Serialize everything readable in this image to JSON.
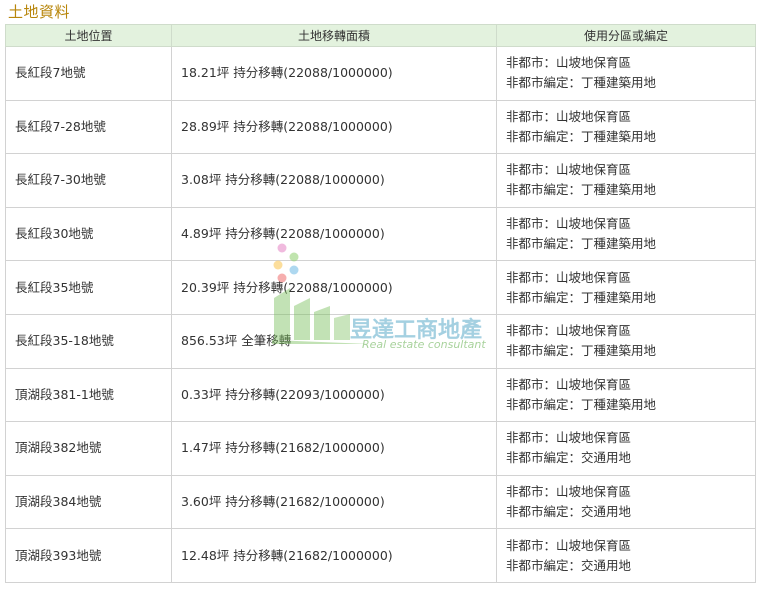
{
  "section_title": "土地資料",
  "table": {
    "headers": [
      "土地位置",
      "土地移轉面積",
      "使用分區或編定"
    ],
    "rows": [
      {
        "location": "長紅段7地號",
        "area": "18.21坪 持分移轉(22088/1000000)",
        "zone1": "非都市：山坡地保育區",
        "zone2": "非都市編定：丁種建築用地"
      },
      {
        "location": "長紅段7-28地號",
        "area": "28.89坪 持分移轉(22088/1000000)",
        "zone1": "非都市：山坡地保育區",
        "zone2": "非都市編定：丁種建築用地"
      },
      {
        "location": "長紅段7-30地號",
        "area": "3.08坪 持分移轉(22088/1000000)",
        "zone1": "非都市：山坡地保育區",
        "zone2": "非都市編定：丁種建築用地"
      },
      {
        "location": "長紅段30地號",
        "area": "4.89坪 持分移轉(22088/1000000)",
        "zone1": "非都市：山坡地保育區",
        "zone2": "非都市編定：丁種建築用地"
      },
      {
        "location": "長紅段35地號",
        "area": "20.39坪 持分移轉(22088/1000000)",
        "zone1": "非都市：山坡地保育區",
        "zone2": "非都市編定：丁種建築用地"
      },
      {
        "location": "長紅段35-18地號",
        "area": "856.53坪 全筆移轉",
        "zone1": "非都市：山坡地保育區",
        "zone2": "非都市編定：丁種建築用地"
      },
      {
        "location": "頂湖段381-1地號",
        "area": "0.33坪 持分移轉(22093/1000000)",
        "zone1": "非都市：山坡地保育區",
        "zone2": "非都市編定：丁種建築用地"
      },
      {
        "location": "頂湖段382地號",
        "area": "1.47坪 持分移轉(21682/1000000)",
        "zone1": "非都市：山坡地保育區",
        "zone2": "非都市編定：交通用地"
      },
      {
        "location": "頂湖段384地號",
        "area": "3.60坪 持分移轉(21682/1000000)",
        "zone1": "非都市：山坡地保育區",
        "zone2": "非都市編定：交通用地"
      },
      {
        "location": "頂湖段393地號",
        "area": "12.48坪 持分移轉(21682/1000000)",
        "zone1": "非都市：山坡地保育區",
        "zone2": "非都市編定：交通用地"
      }
    ]
  },
  "watermark": {
    "name": "昱達工商地產",
    "subtitle": "Real estate consultant"
  },
  "colors": {
    "title": "#b8860b",
    "header_bg": "#e3f2de",
    "border": "#d2d2d2"
  }
}
